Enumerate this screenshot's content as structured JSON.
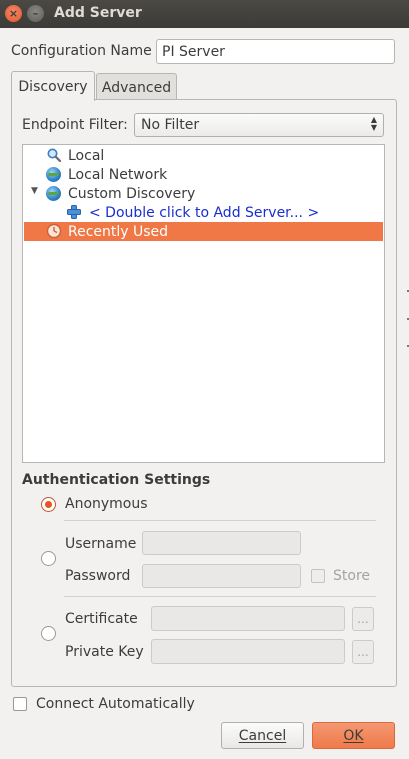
{
  "window": {
    "title": "Add Server",
    "close_glyph": "×",
    "min_glyph": "–"
  },
  "config": {
    "name_label": "Configuration Name",
    "name_value": "PI Server"
  },
  "tabs": [
    {
      "label": "Discovery",
      "active": true
    },
    {
      "label": "Advanced",
      "active": false
    }
  ],
  "discovery": {
    "filter_label": "Endpoint Filter:",
    "filter_value": "No Filter",
    "tree": [
      {
        "label": "Local",
        "icon": "magnifier-icon"
      },
      {
        "label": "Local Network",
        "icon": "globe-icon"
      },
      {
        "label": "Custom Discovery",
        "icon": "globe-icon",
        "expanded": true
      },
      {
        "label": "< Double click to Add Server... >",
        "icon": "plus-icon",
        "color": "#1a2ecf"
      },
      {
        "label": "Recently Used",
        "icon": "clock-icon",
        "selected": true
      }
    ]
  },
  "auth": {
    "title": "Authentication Settings",
    "anonymous_label": "Anonymous",
    "username_label": "Username",
    "username_value": "",
    "password_label": "Password",
    "password_value": "",
    "store_label": "Store",
    "certificate_label": "Certificate",
    "certificate_value": "",
    "private_key_label": "Private Key",
    "private_key_value": "",
    "browse_label": "...",
    "selected_mode": "Anonymous"
  },
  "footer": {
    "connect_auto_label": "Connect Automatically",
    "cancel_label": "Cancel",
    "ok_label": "OK"
  },
  "colors": {
    "accent": "#f07746",
    "link": "#1a2ecf",
    "titlebar": "#3c3b37"
  }
}
